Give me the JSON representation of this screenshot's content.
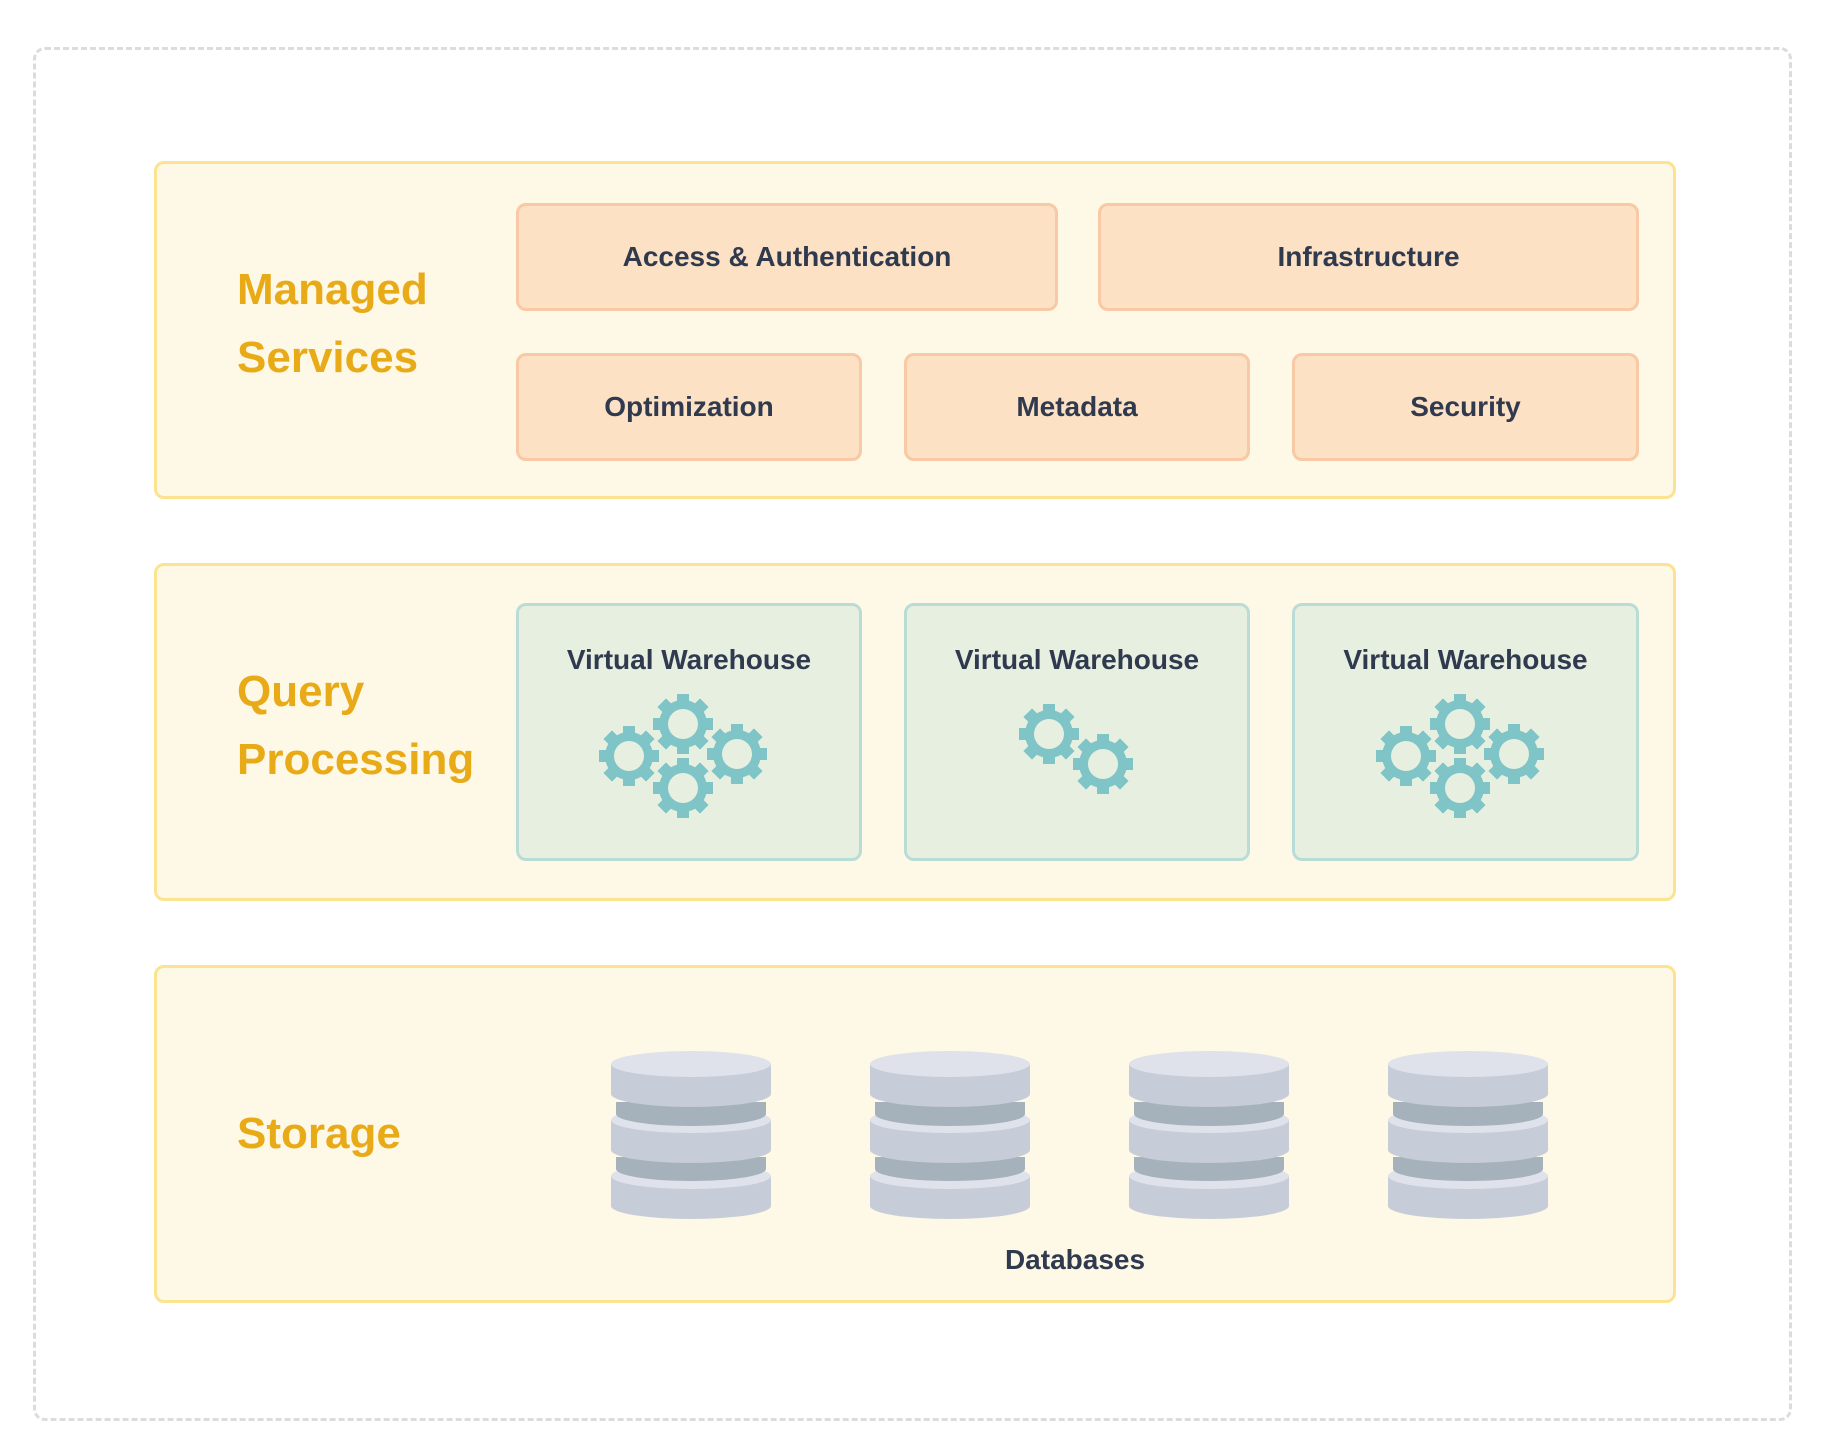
{
  "layers": [
    {
      "title_lines": [
        "Managed",
        "Services"
      ],
      "services": [
        "Access & Authentication",
        "Infrastructure",
        "Optimization",
        "Metadata",
        "Security"
      ]
    },
    {
      "title_lines": [
        "Query",
        "Processing"
      ],
      "warehouses": [
        {
          "label": "Virtual Warehouse",
          "gear_count": 4
        },
        {
          "label": "Virtual Warehouse",
          "gear_count": 2
        },
        {
          "label": "Virtual Warehouse",
          "gear_count": 4
        }
      ]
    },
    {
      "title_lines": [
        "Storage"
      ],
      "database_count": 4,
      "databases_label": "Databases"
    }
  ],
  "colors": {
    "label": "#e8aa17",
    "panel_bg": "#fef8e7",
    "panel_border": "#fce38f",
    "service_bg": "#fce1c4",
    "warehouse_bg": "#e7efe1",
    "gear": "#7fc4c6",
    "database": "#c6ccd8"
  },
  "icons": {
    "gear": "gear-icon",
    "database": "database-icon"
  }
}
